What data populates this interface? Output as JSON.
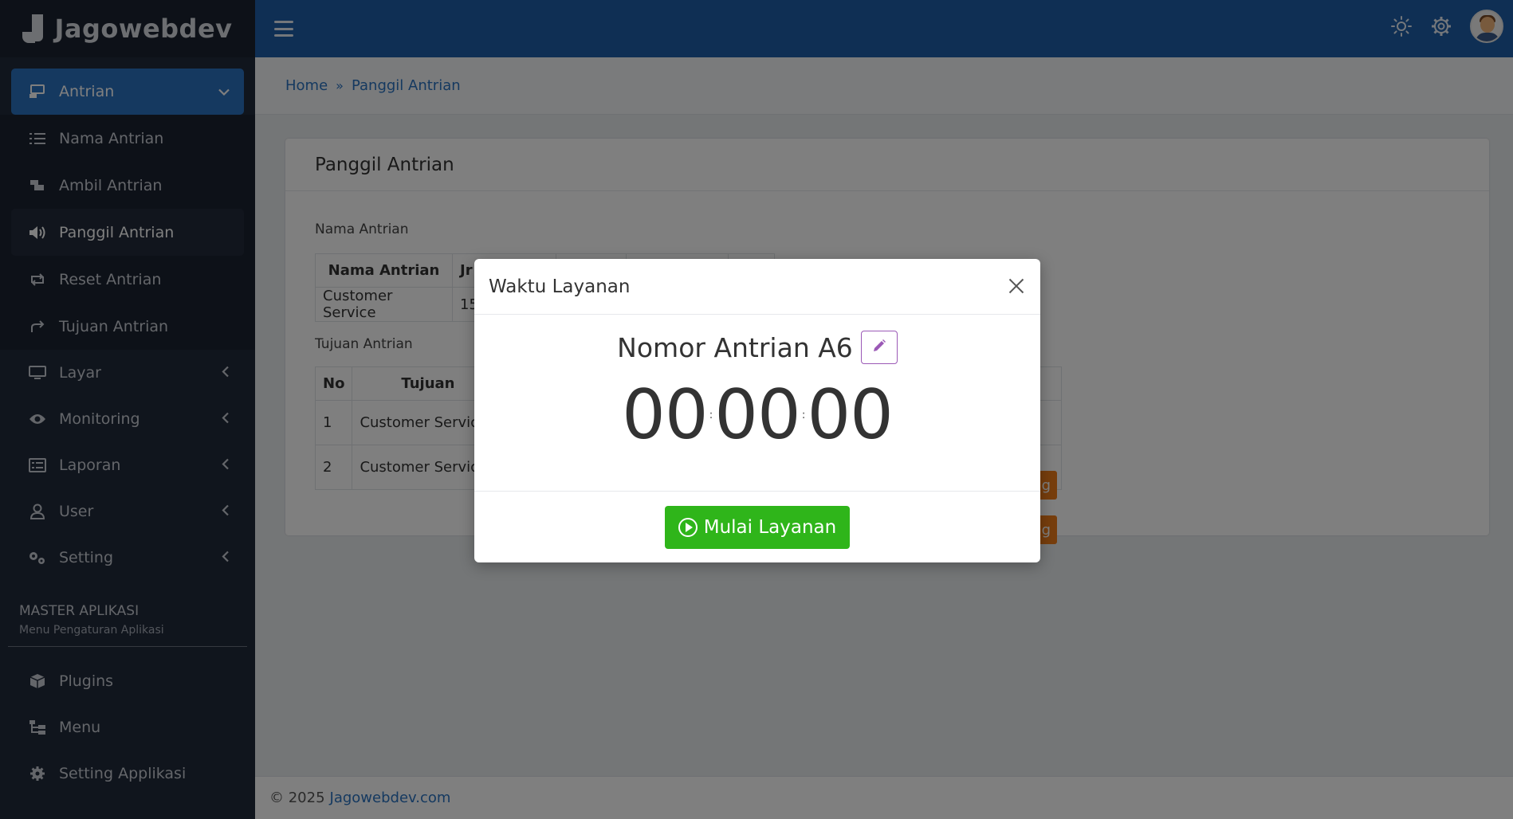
{
  "brand": {
    "name": "Jagowebdev"
  },
  "sidebar": {
    "parent": {
      "label": "Antrian",
      "icon": "queue-icon"
    },
    "subitems": [
      {
        "label": "Nama Antrian",
        "icon": "list-icon"
      },
      {
        "label": "Ambil Antrian",
        "icon": "ticket-icon"
      },
      {
        "label": "Panggil Antrian",
        "icon": "megaphone-icon"
      },
      {
        "label": "Reset Antrian",
        "icon": "reset-icon"
      },
      {
        "label": "Tujuan Antrian",
        "icon": "share-icon"
      }
    ],
    "items": [
      {
        "label": "Layar",
        "icon": "monitor-icon"
      },
      {
        "label": "Monitoring",
        "icon": "eye-icon"
      },
      {
        "label": "Laporan",
        "icon": "report-icon"
      },
      {
        "label": "User",
        "icon": "user-icon"
      },
      {
        "label": "Setting",
        "icon": "gears-icon"
      }
    ],
    "section": {
      "title": "MASTER APLIKASI",
      "subtitle": "Menu Pengaturan Aplikasi"
    },
    "master_items": [
      {
        "label": "Plugins",
        "icon": "box-icon"
      },
      {
        "label": "Menu",
        "icon": "menu-tree-icon"
      },
      {
        "label": "Setting Applikasi",
        "icon": "gear-icon"
      }
    ]
  },
  "breadcrumb": {
    "home": "Home",
    "current": "Panggil Antrian"
  },
  "card": {
    "title": "Panggil Antrian",
    "nama_label": "Nama Antrian",
    "table1": {
      "headers": [
        "Nama Antrian",
        "Jr"
      ],
      "row": [
        "Customer Service",
        "15"
      ]
    },
    "tujuan_label": "Tujuan Antrian",
    "table2": {
      "headers": [
        "No",
        "Tujuan"
      ],
      "rows": [
        [
          "1",
          "Customer Service"
        ],
        [
          "2",
          "Customer Service"
        ]
      ]
    },
    "button_partial": "g"
  },
  "footer": {
    "copyright": "© 2025",
    "link": "Jagowebdev.com"
  },
  "modal": {
    "title": "Waktu Layanan",
    "queue_label": "Nomor Antrian A6",
    "timer": {
      "hours": "00",
      "minutes": "00",
      "seconds": "00",
      "separator": ":"
    },
    "start_button": "Mulai Layanan"
  }
}
